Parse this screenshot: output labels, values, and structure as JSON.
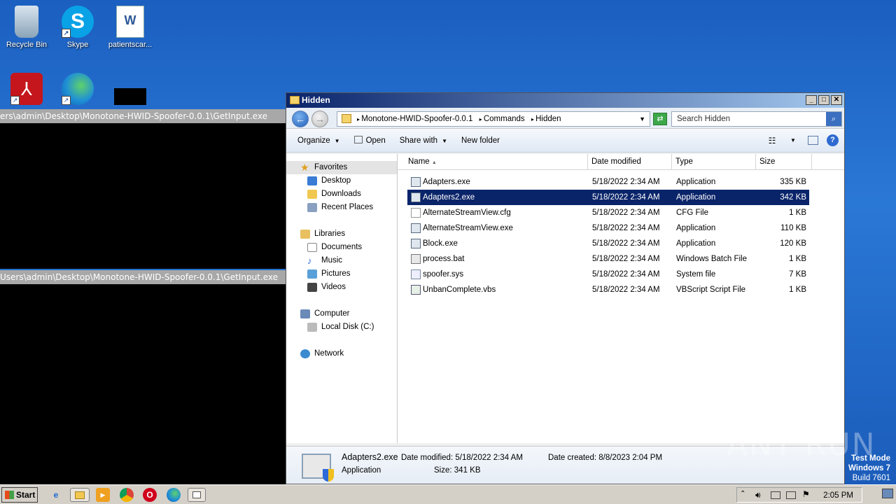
{
  "desktop": {
    "icons": [
      {
        "label": "Recycle Bin"
      },
      {
        "label": "Skype"
      },
      {
        "label": "patientscar..."
      },
      {
        "label": ""
      },
      {
        "label": ""
      },
      {
        "label": ""
      }
    ]
  },
  "consoles": [
    {
      "title": "ers\\admin\\Desktop\\Monotone-HWID-Spoofer-0.0.1\\GetInput.exe"
    },
    {
      "title": "Users\\admin\\Desktop\\Monotone-HWID-Spoofer-0.0.1\\GetInput.exe"
    }
  ],
  "explorer": {
    "title": "Hidden",
    "address": [
      "Monotone-HWID-Spoofer-0.0.1",
      "Commands",
      "Hidden"
    ],
    "search_placeholder": "Search Hidden",
    "toolbar": {
      "organize": "Organize",
      "open": "Open",
      "share_with": "Share with",
      "new_folder": "New folder"
    },
    "nav": {
      "favorites": "Favorites",
      "desktop": "Desktop",
      "downloads": "Downloads",
      "recent_places": "Recent Places",
      "libraries": "Libraries",
      "documents": "Documents",
      "music": "Music",
      "pictures": "Pictures",
      "videos": "Videos",
      "computer": "Computer",
      "local_disk": "Local Disk (C:)",
      "network": "Network"
    },
    "columns": {
      "name": "Name",
      "date": "Date modified",
      "type": "Type",
      "size": "Size"
    },
    "files": [
      {
        "name": "Adapters.exe",
        "date": "5/18/2022 2:34 AM",
        "type": "Application",
        "size": "335 KB",
        "icon": "app-icon"
      },
      {
        "name": "Adapters2.exe",
        "date": "5/18/2022 2:34 AM",
        "type": "Application",
        "size": "342 KB",
        "icon": "app-icon",
        "selected": true
      },
      {
        "name": "AlternateStreamView.cfg",
        "date": "5/18/2022 2:34 AM",
        "type": "CFG File",
        "size": "1 KB",
        "icon": "file-icon"
      },
      {
        "name": "AlternateStreamView.exe",
        "date": "5/18/2022 2:34 AM",
        "type": "Application",
        "size": "110 KB",
        "icon": "app-icon"
      },
      {
        "name": "Block.exe",
        "date": "5/18/2022 2:34 AM",
        "type": "Application",
        "size": "120 KB",
        "icon": "app-icon"
      },
      {
        "name": "process.bat",
        "date": "5/18/2022 2:34 AM",
        "type": "Windows Batch File",
        "size": "1 KB",
        "icon": "batch-icon"
      },
      {
        "name": "spoofer.sys",
        "date": "5/18/2022 2:34 AM",
        "type": "System file",
        "size": "7 KB",
        "icon": "sys-icon"
      },
      {
        "name": "UnbanComplete.vbs",
        "date": "5/18/2022 2:34 AM",
        "type": "VBScript Script File",
        "size": "1 KB",
        "icon": "script-icon"
      }
    ],
    "details": {
      "name": "Adapters2.exe",
      "kind": "Application",
      "modified_label": "Date modified:",
      "modified": "5/18/2022 2:34 AM",
      "size_label": "Size:",
      "size": "341 KB",
      "created_label": "Date created:",
      "created": "8/8/2023 2:04 PM"
    }
  },
  "taskbar": {
    "start": "Start",
    "clock": "2:05 PM"
  },
  "watermark": {
    "line1": "Test Mode",
    "line2": "Windows 7",
    "line3": "Build 7601",
    "brand": "ANY RUN"
  }
}
